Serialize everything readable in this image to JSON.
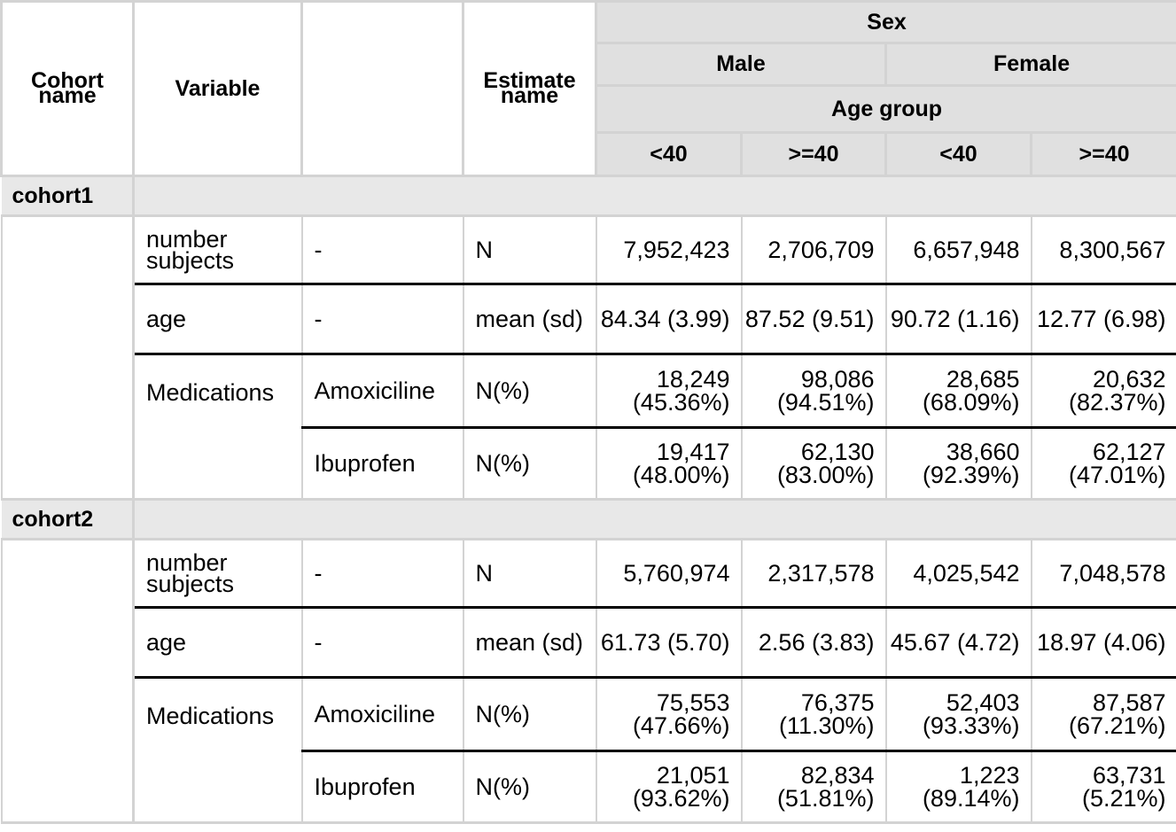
{
  "header": {
    "cohort_name": "Cohort name",
    "variable": "Variable",
    "blank": "",
    "estimate_name": "Estimate name",
    "sex": "Sex",
    "male": "Male",
    "female": "Female",
    "age_group": "Age group",
    "age_levels": [
      "<40",
      ">=40",
      "<40",
      ">=40"
    ]
  },
  "groups": [
    {
      "name": "cohort1",
      "rows": [
        {
          "variable": "number subjects",
          "level": "-",
          "estimate": "N",
          "values": [
            "7,952,423",
            "2,706,709",
            "6,657,948",
            "8,300,567"
          ]
        },
        {
          "variable": "age",
          "level": "-",
          "estimate": "mean (sd)",
          "values": [
            "84.34 (3.99)",
            "87.52 (9.51)",
            "90.72 (1.16)",
            "12.77 (6.98)"
          ]
        },
        {
          "variable": "Medications",
          "level": "Amoxiciline",
          "estimate": "N(%)",
          "values": [
            "18,249 (45.36%)",
            "98,086 (94.51%)",
            "28,685 (68.09%)",
            "20,632 (82.37%)"
          ]
        },
        {
          "variable": "",
          "level": "Ibuprofen",
          "estimate": "N(%)",
          "values": [
            "19,417 (48.00%)",
            "62,130 (83.00%)",
            "38,660 (92.39%)",
            "62,127 (47.01%)"
          ]
        }
      ]
    },
    {
      "name": "cohort2",
      "rows": [
        {
          "variable": "number subjects",
          "level": "-",
          "estimate": "N",
          "values": [
            "5,760,974",
            "2,317,578",
            "4,025,542",
            "7,048,578"
          ]
        },
        {
          "variable": "age",
          "level": "-",
          "estimate": "mean (sd)",
          "values": [
            "61.73 (5.70)",
            "2.56 (3.83)",
            "45.67 (4.72)",
            "18.97 (4.06)"
          ]
        },
        {
          "variable": "Medications",
          "level": "Amoxiciline",
          "estimate": "N(%)",
          "values": [
            "75,553 (47.66%)",
            "76,375 (11.30%)",
            "52,403 (93.33%)",
            "87,587 (67.21%)"
          ]
        },
        {
          "variable": "",
          "level": "Ibuprofen",
          "estimate": "N(%)",
          "values": [
            "21,051 (93.62%)",
            "82,834 (51.81%)",
            "1,223 (89.14%)",
            "63,731 (5.21%)"
          ]
        }
      ]
    }
  ]
}
